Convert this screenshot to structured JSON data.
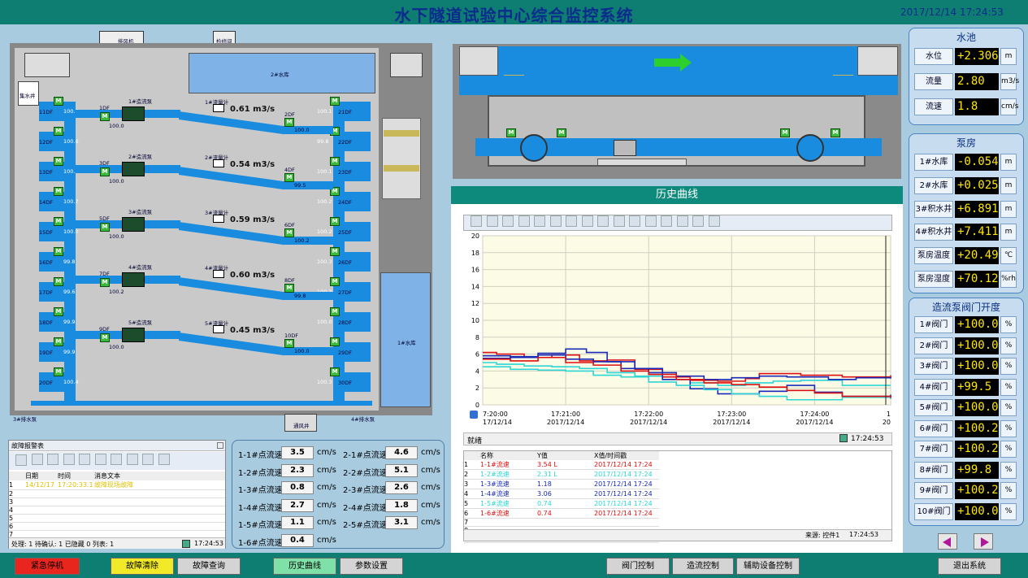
{
  "header": {
    "title": "水下隧道试验中心综合监控系统",
    "datetime": "2017/12/14 17:24:53"
  },
  "plan": {
    "labels": {
      "pump_room_left": "排风机",
      "maint_room": "检修间",
      "reservoir2": "2#水库",
      "sump_left": "集水井",
      "reservoir1": "1#水库",
      "pump3": "3#排水泵",
      "pump4": "4#排水泵",
      "passage": "通风井"
    },
    "valves_left": [
      "11DF",
      "12DF",
      "13DF",
      "14DF",
      "15DF",
      "16DF",
      "17DF",
      "18DF",
      "19DF",
      "20DF"
    ],
    "valves_left_vals": [
      "100.0",
      "100.6",
      "100.3",
      "100.7",
      "100.0",
      "99.8",
      "99.6",
      "99.9",
      "99.9",
      "100.4"
    ],
    "valves_right": [
      "21DF",
      "22DF",
      "23DF",
      "24DF",
      "25DF",
      "26DF",
      "27DF",
      "28DF",
      "29DF",
      "30DF"
    ],
    "valves_right_vals": [
      "100.1",
      "99.8",
      "100.1",
      "100.2",
      "100.2",
      "100.3",
      "100.3",
      "100.0",
      "100.4",
      "100.3"
    ],
    "pumps": [
      {
        "name": "1#造流泵",
        "meter": "1#流量计",
        "flow": "0.61 m3/s",
        "in": "1DF",
        "out": "2DF",
        "in_val": "100.0",
        "out_val": "100.0"
      },
      {
        "name": "2#造流泵",
        "meter": "2#流量计",
        "flow": "0.54 m3/s",
        "in": "3DF",
        "out": "4DF",
        "in_val": "100.0",
        "out_val": "99.5"
      },
      {
        "name": "3#造流泵",
        "meter": "3#流量计",
        "flow": "0.59 m3/s",
        "in": "5DF",
        "out": "6DF",
        "in_val": "100.0",
        "out_val": "100.2"
      },
      {
        "name": "4#造流泵",
        "meter": "4#流量计",
        "flow": "0.60 m3/s",
        "in": "7DF",
        "out": "8DF",
        "in_val": "100.2",
        "out_val": "99.8"
      },
      {
        "name": "5#造流泵",
        "meter": "5#流量计",
        "flow": "0.45 m3/s",
        "in": "9DF",
        "out": "10DF",
        "in_val": "100.0",
        "out_val": "100.0"
      }
    ]
  },
  "history": {
    "title": "历史曲线",
    "status_left": "就绪",
    "status_time": "17:24:53",
    "source_label": "来源: 控件1",
    "source_time": "17:24:53",
    "table_headers": [
      "名称",
      "Y值",
      "X值/时间戳"
    ],
    "table_rows": [
      {
        "idx": "1",
        "name": "1-1#流速",
        "y": "3.54 L",
        "x": "2017/12/14 17:24",
        "color": "#d11"
      },
      {
        "idx": "2",
        "name": "1-2#流速",
        "y": "2.31 L",
        "x": "2017/12/14 17:24",
        "color": "#2cd6d6"
      },
      {
        "idx": "3",
        "name": "1-3#流速",
        "y": "1.18",
        "x": "2017/12/14 17:24",
        "color": "#1a2ab8"
      },
      {
        "idx": "4",
        "name": "1-4#流速",
        "y": "3.06",
        "x": "2017/12/14 17:24",
        "color": "#1a2ab8"
      },
      {
        "idx": "5",
        "name": "1-5#流速",
        "y": "0.74",
        "x": "2017/12/14 17:24",
        "color": "#2cd6d6"
      },
      {
        "idx": "6",
        "name": "1-6#流速",
        "y": "0.74",
        "x": "2017/12/14 17:24",
        "color": "#d11"
      },
      {
        "idx": "7",
        "name": "",
        "y": "",
        "x": "",
        "color": "#000"
      },
      {
        "idx": "8",
        "name": "",
        "y": "",
        "x": "",
        "color": "#000"
      },
      {
        "idx": "9",
        "name": "",
        "y": "",
        "x": "",
        "color": "#000"
      }
    ]
  },
  "chart_data": {
    "type": "line",
    "ylim": [
      0,
      20
    ],
    "yticks": [
      0,
      2,
      4,
      6,
      8,
      10,
      12,
      14,
      16,
      18,
      20
    ],
    "xticks": [
      {
        "t": 0,
        "time": "7:20:00",
        "date": "17/12/14"
      },
      {
        "t": 60,
        "time": "17:21:00",
        "date": "2017/12/14"
      },
      {
        "t": 120,
        "time": "17:22:00",
        "date": "2017/12/14"
      },
      {
        "t": 180,
        "time": "17:23:00",
        "date": "2017/12/14"
      },
      {
        "t": 240,
        "time": "17:24:00",
        "date": "2017/12/14"
      },
      {
        "t": 295,
        "time": "1",
        "date": "20"
      }
    ],
    "xlim": [
      0,
      295
    ],
    "series": [
      {
        "name": "1-1#流速",
        "color": "#d11",
        "points": [
          [
            0,
            6.2
          ],
          [
            10,
            6.0
          ],
          [
            30,
            5.6
          ],
          [
            50,
            5.9
          ],
          [
            70,
            5.2
          ],
          [
            90,
            5.3
          ],
          [
            110,
            4.2
          ],
          [
            130,
            3.3
          ],
          [
            150,
            2.9
          ],
          [
            170,
            2.8
          ],
          [
            190,
            3.1
          ],
          [
            200,
            3.7
          ],
          [
            230,
            3.5
          ],
          [
            260,
            3.3
          ],
          [
            295,
            3.5
          ]
        ]
      },
      {
        "name": "1-2#流速",
        "color": "#2cd6d6",
        "points": [
          [
            0,
            5.0
          ],
          [
            10,
            4.8
          ],
          [
            30,
            4.6
          ],
          [
            50,
            4.5
          ],
          [
            70,
            4.3
          ],
          [
            90,
            3.8
          ],
          [
            110,
            3.4
          ],
          [
            130,
            3.0
          ],
          [
            150,
            2.6
          ],
          [
            170,
            2.3
          ],
          [
            190,
            2.6
          ],
          [
            210,
            2.8
          ],
          [
            230,
            2.9
          ],
          [
            260,
            2.3
          ],
          [
            295,
            2.3
          ]
        ]
      },
      {
        "name": "1-3#流速",
        "color": "#1a2ab8",
        "points": [
          [
            0,
            5.8
          ],
          [
            20,
            5.6
          ],
          [
            40,
            6.1
          ],
          [
            60,
            6.6
          ],
          [
            75,
            6.2
          ],
          [
            90,
            5.1
          ],
          [
            110,
            4.3
          ],
          [
            130,
            3.0
          ],
          [
            150,
            1.9
          ],
          [
            170,
            1.3
          ],
          [
            200,
            1.6
          ],
          [
            220,
            2.3
          ],
          [
            240,
            1.5
          ],
          [
            260,
            1.0
          ],
          [
            295,
            1.2
          ]
        ]
      },
      {
        "name": "1-4#流速",
        "color": "#1a2ab8",
        "points": [
          [
            0,
            5.5
          ],
          [
            20,
            5.7
          ],
          [
            40,
            5.9
          ],
          [
            60,
            5.4
          ],
          [
            80,
            5.1
          ],
          [
            100,
            4.3
          ],
          [
            120,
            3.8
          ],
          [
            140,
            3.4
          ],
          [
            160,
            3.0
          ],
          [
            180,
            3.2
          ],
          [
            200,
            3.4
          ],
          [
            220,
            3.3
          ],
          [
            250,
            3.0
          ],
          [
            270,
            3.2
          ],
          [
            295,
            3.1
          ]
        ]
      },
      {
        "name": "1-5#流速",
        "color": "#2cd6d6",
        "points": [
          [
            0,
            4.5
          ],
          [
            20,
            4.2
          ],
          [
            40,
            4.1
          ],
          [
            60,
            4.0
          ],
          [
            80,
            3.5
          ],
          [
            100,
            3.3
          ],
          [
            120,
            2.7
          ],
          [
            140,
            2.3
          ],
          [
            160,
            1.8
          ],
          [
            180,
            1.3
          ],
          [
            200,
            1.0
          ],
          [
            220,
            0.6
          ],
          [
            240,
            0.6
          ],
          [
            260,
            0.9
          ],
          [
            295,
            0.7
          ]
        ]
      },
      {
        "name": "1-6#流速",
        "color": "#d11",
        "points": [
          [
            0,
            5.4
          ],
          [
            20,
            5.2
          ],
          [
            40,
            5.6
          ],
          [
            60,
            5.0
          ],
          [
            80,
            4.7
          ],
          [
            100,
            4.0
          ],
          [
            120,
            3.6
          ],
          [
            140,
            3.0
          ],
          [
            160,
            2.6
          ],
          [
            180,
            2.4
          ],
          [
            200,
            2.1
          ],
          [
            220,
            1.7
          ],
          [
            240,
            1.4
          ],
          [
            260,
            1.0
          ],
          [
            295,
            0.8
          ]
        ]
      }
    ]
  },
  "fault": {
    "title": "故障报警表",
    "headers": [
      "日期",
      "时间",
      "消息文本"
    ],
    "rows": [
      {
        "idx": "1",
        "date": "14/12/17",
        "time": "17:20:33.1",
        "msg": "故障现场故障"
      },
      {
        "idx": "2",
        "date": "",
        "time": "",
        "msg": ""
      },
      {
        "idx": "3",
        "date": "",
        "time": "",
        "msg": ""
      },
      {
        "idx": "4",
        "date": "",
        "time": "",
        "msg": ""
      },
      {
        "idx": "5",
        "date": "",
        "time": "",
        "msg": ""
      },
      {
        "idx": "6",
        "date": "",
        "time": "",
        "msg": ""
      },
      {
        "idx": "7",
        "date": "",
        "time": "",
        "msg": ""
      }
    ],
    "status": "处理: 1  待确认: 1  已隐藏 0  列表: 1",
    "time": "17:24:53"
  },
  "flows_left": [
    {
      "label": "1-1#点流速",
      "val": "3.5"
    },
    {
      "label": "1-2#点流速",
      "val": "2.3"
    },
    {
      "label": "1-3#点流速",
      "val": "0.8"
    },
    {
      "label": "1-4#点流速",
      "val": "2.7"
    },
    {
      "label": "1-5#点流速",
      "val": "1.1"
    },
    {
      "label": "1-6#点流速",
      "val": "0.4"
    }
  ],
  "flows_right": [
    {
      "label": "2-1#点流速",
      "val": "4.6"
    },
    {
      "label": "2-2#点流速",
      "val": "5.1"
    },
    {
      "label": "2-3#点流速",
      "val": "2.6"
    },
    {
      "label": "2-4#点流速",
      "val": "1.8"
    },
    {
      "label": "2-5#点流速",
      "val": "3.1"
    }
  ],
  "flow_unit": "cm/s",
  "pool": {
    "title": "水池",
    "rows": [
      {
        "label": "水位",
        "value": "+2.306",
        "unit": "m"
      },
      {
        "label": "流量",
        "value": "2.80",
        "unit": "m3/s"
      },
      {
        "label": "流速",
        "value": "1.8",
        "unit": "cm/s"
      }
    ]
  },
  "pumproom": {
    "title": "泵房",
    "rows": [
      {
        "label": "1#水库",
        "value": "-0.054",
        "unit": "m"
      },
      {
        "label": "2#水库",
        "value": "+0.025",
        "unit": "m"
      },
      {
        "label": "3#积水井",
        "value": "+6.891",
        "unit": "m"
      },
      {
        "label": "4#积水井",
        "value": "+7.411",
        "unit": "m"
      },
      {
        "label": "泵房温度",
        "value": "+20.49",
        "unit": "℃"
      },
      {
        "label": "泵房湿度",
        "value": "+70.12",
        "unit": "%rh"
      }
    ]
  },
  "valves": {
    "title": "造流泵阀门开度",
    "rows": [
      {
        "label": "1#阀门",
        "value": "+100.0",
        "unit": "%"
      },
      {
        "label": "2#阀门",
        "value": "+100.0",
        "unit": "%"
      },
      {
        "label": "3#阀门",
        "value": "+100.0",
        "unit": "%"
      },
      {
        "label": "4#阀门",
        "value": "+99.5",
        "unit": "%"
      },
      {
        "label": "5#阀门",
        "value": "+100.0",
        "unit": "%"
      },
      {
        "label": "6#阀门",
        "value": "+100.2",
        "unit": "%"
      },
      {
        "label": "7#阀门",
        "value": "+100.2",
        "unit": "%"
      },
      {
        "label": "8#阀门",
        "value": "+99.8",
        "unit": "%"
      },
      {
        "label": "9#阀门",
        "value": "+100.2",
        "unit": "%"
      },
      {
        "label": "10#阀门",
        "value": "+100.0",
        "unit": "%"
      }
    ]
  },
  "nav": {
    "prev_icon": "left-arrow-icon",
    "next_icon": "right-arrow-icon"
  },
  "buttons": {
    "emergency": "紧急停机",
    "clear_fault": "故障清除",
    "fault_query": "故障查询",
    "history": "历史曲线",
    "params": "参数设置",
    "valve_ctrl": "阀门控制",
    "flow_ctrl": "造流控制",
    "aux_ctrl": "辅助设备控制",
    "exit": "退出系统"
  },
  "colors": {
    "emergency": "#e8261e",
    "clear_fault": "#f2ea28",
    "active_tab": "#7fe0a8",
    "value_bg": "#000000",
    "value_fg": "#ffe600"
  }
}
